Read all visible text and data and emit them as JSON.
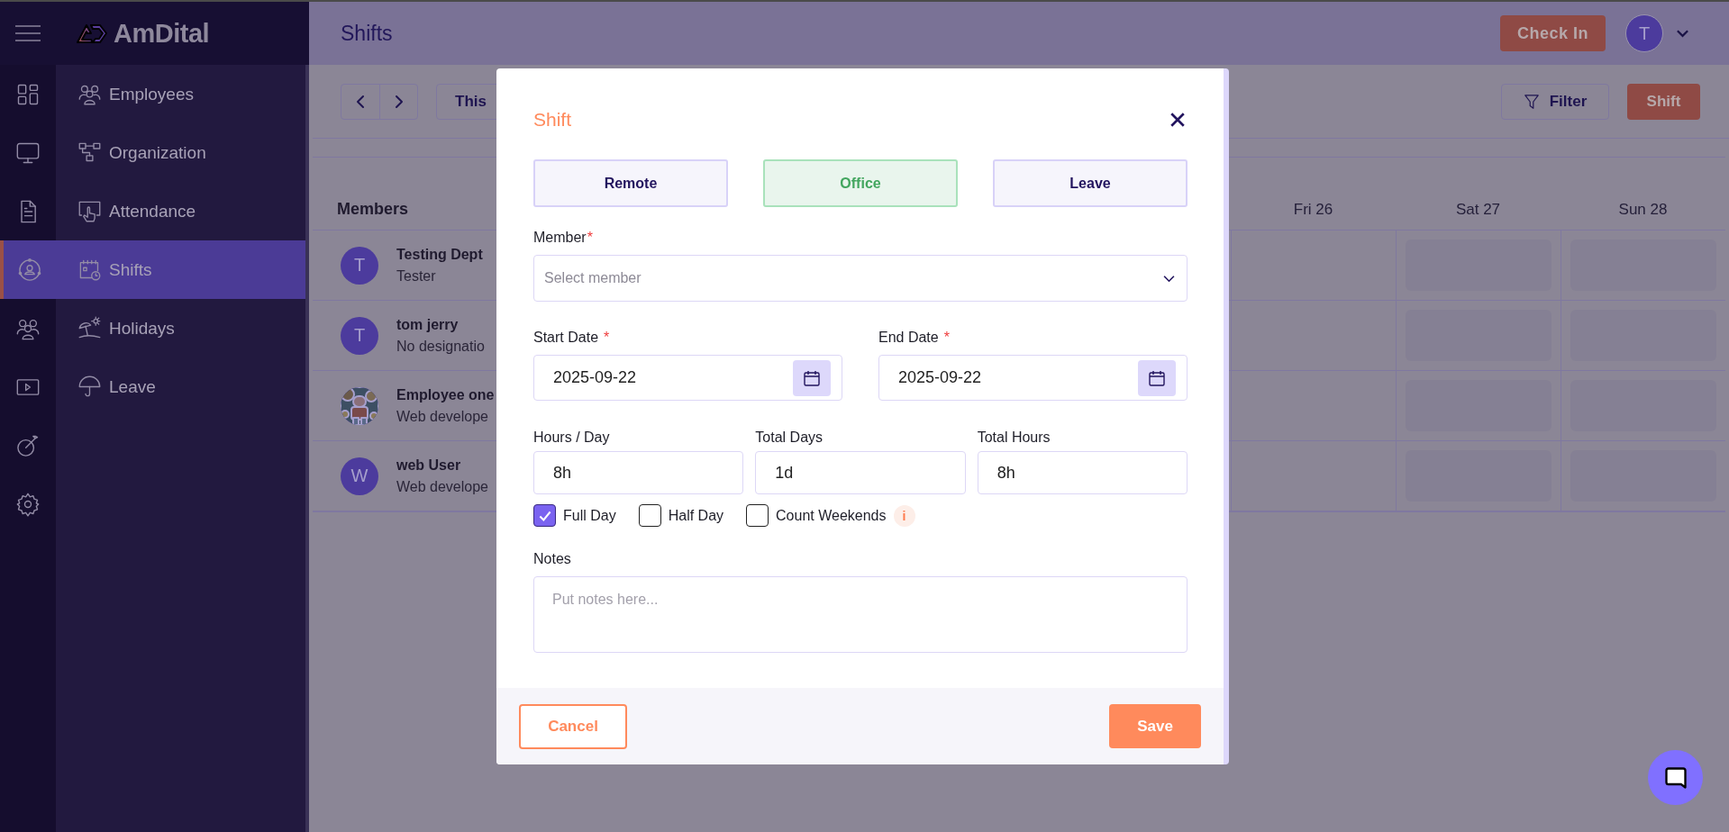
{
  "app": {
    "logo": "AmDital"
  },
  "rail": [
    {
      "kind": "grid",
      "selected": false
    },
    {
      "kind": "monitor",
      "selected": false
    },
    {
      "kind": "document",
      "selected": false
    },
    {
      "kind": "user-circle",
      "selected": true
    },
    {
      "kind": "people",
      "selected": false
    },
    {
      "kind": "video",
      "selected": false
    },
    {
      "kind": "target",
      "selected": false
    },
    {
      "kind": "gear",
      "selected": false
    }
  ],
  "sidebar": {
    "items": [
      {
        "label": "Employees",
        "kind": "people",
        "selected": false
      },
      {
        "label": "Organization",
        "kind": "org",
        "selected": false
      },
      {
        "label": "Attendance",
        "kind": "touch",
        "selected": false
      },
      {
        "label": "Shifts",
        "kind": "calendar-clock",
        "selected": true
      },
      {
        "label": "Holidays",
        "kind": "beach",
        "selected": false
      },
      {
        "label": "Leave",
        "kind": "umbrella",
        "selected": false
      }
    ]
  },
  "header": {
    "title": "Shifts",
    "check_in": "Check In",
    "avatar": "T"
  },
  "toolbar": {
    "period": "This",
    "filter": "Filter",
    "add": "Shift"
  },
  "table": {
    "members_header": "Members",
    "columns": [
      {
        "label": "Fri 26",
        "kind": "weekday"
      },
      {
        "label": "Sat 27",
        "kind": "weekend"
      },
      {
        "label": "Sun 28",
        "kind": "weekend"
      }
    ],
    "rows": [
      {
        "name": "Testing Dept",
        "role": "Tester",
        "avatar": {
          "kind": "initial",
          "initial": "T"
        }
      },
      {
        "name": "tom jerry",
        "role": "No designatio",
        "avatar": {
          "kind": "initial",
          "initial": "T"
        }
      },
      {
        "name": "Employee one",
        "role": "Web develope"
      },
      {
        "name": "web User",
        "role": "Web develope",
        "avatar": {
          "kind": "initial",
          "initial": "W"
        }
      }
    ]
  },
  "modal": {
    "title": "Shift",
    "types": [
      {
        "label": "Remote",
        "selected": false
      },
      {
        "label": "Office",
        "selected": true
      },
      {
        "label": "Leave",
        "selected": false
      }
    ],
    "member": {
      "label": "Member",
      "required_mark": "*",
      "placeholder": "Select member"
    },
    "start_date": {
      "label": "Start Date",
      "required_mark": "*",
      "value": "2025-09-22"
    },
    "end_date": {
      "label": "End Date",
      "required_mark": "*",
      "value": "2025-09-22"
    },
    "stats": [
      {
        "label": "Hours / Day",
        "value": "8h"
      },
      {
        "label": "Total Days",
        "value": "1d"
      },
      {
        "label": "Total Hours",
        "value": "8h"
      }
    ],
    "options": [
      {
        "label": "Full Day",
        "checked": true
      },
      {
        "label": "Half Day",
        "checked": false
      },
      {
        "label": "Count Weekends",
        "checked": false,
        "info": "i"
      }
    ],
    "notes": {
      "label": "Notes",
      "placeholder": "Put notes here..."
    },
    "cancel": "Cancel",
    "save": "Save"
  }
}
